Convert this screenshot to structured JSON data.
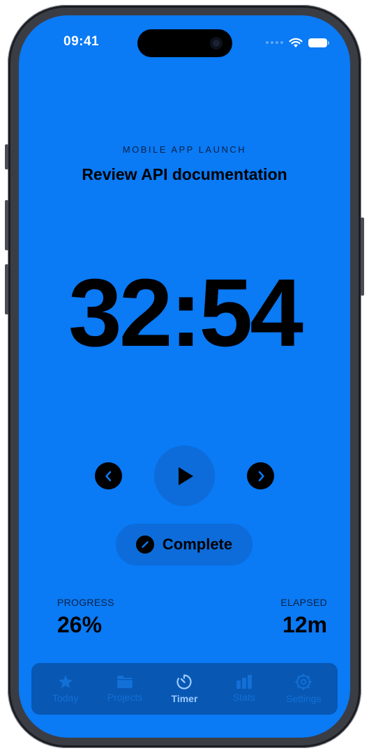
{
  "status_bar": {
    "time": "09:41"
  },
  "task": {
    "project": "MOBILE APP LAUNCH",
    "title": "Review API documentation"
  },
  "timer": {
    "display": "32:54"
  },
  "controls": {
    "prev_icon": "chevron-left-icon",
    "play_icon": "play-icon",
    "next_icon": "chevron-right-icon"
  },
  "complete_button": {
    "label": "Complete"
  },
  "stats": {
    "progress_label": "PROGRESS",
    "progress_value": "26%",
    "elapsed_label": "ELAPSED",
    "elapsed_value": "12m"
  },
  "tabbar": {
    "tabs": [
      {
        "label": "Today",
        "icon": "star-icon"
      },
      {
        "label": "Projects",
        "icon": "folder-icon"
      },
      {
        "label": "Timer",
        "icon": "timer-icon",
        "active": true
      },
      {
        "label": "Stats",
        "icon": "bar-chart-icon"
      },
      {
        "label": "Settings",
        "icon": "gear-icon"
      }
    ]
  },
  "colors": {
    "background": "#0a7af5",
    "surface": "#0d6cd9",
    "tabbar": "#0857b3",
    "active_tab": "#9ccaff",
    "inactive_tab": "#1270d6",
    "text": "#000000"
  }
}
